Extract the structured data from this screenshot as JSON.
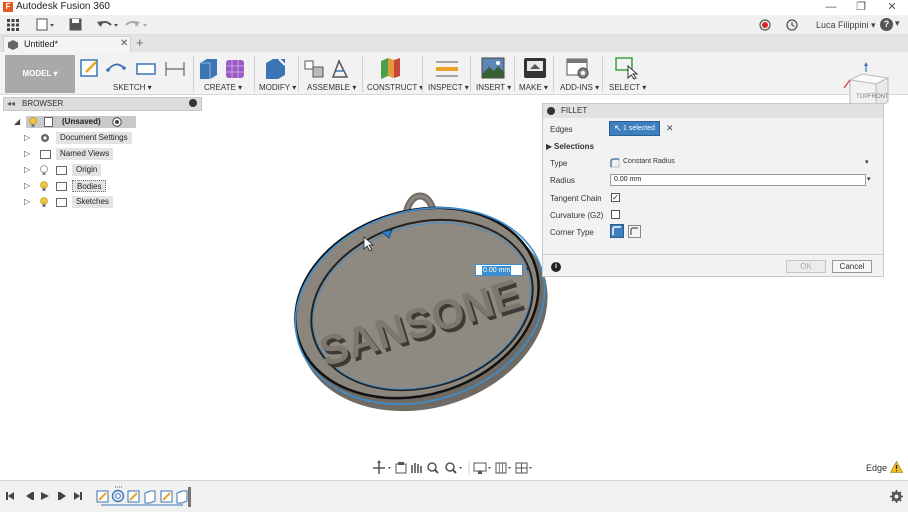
{
  "window": {
    "title": "Autodesk Fusion 360",
    "logo_letter": "F",
    "minimize": "—",
    "restore": "❐",
    "close": "✕"
  },
  "quickbar": {
    "user_name": "Luca Filippini",
    "user_caret": "▾",
    "help_label": "?",
    "help_caret": "▾"
  },
  "tab": {
    "name": "Untitled*",
    "close": "✕",
    "new_tab": "+"
  },
  "ribbon": {
    "workspace": "MODEL",
    "workspace_caret": "▾",
    "groups": [
      "SKETCH",
      "CREATE",
      "MODIFY",
      "ASSEMBLE",
      "CONSTRUCT",
      "INSPECT",
      "INSERT",
      "MAKE",
      "ADD-INS",
      "SELECT"
    ]
  },
  "viewcube": {
    "front_label": "FRONT",
    "top_label": "TOP"
  },
  "browser": {
    "title": "BROWSER",
    "root": "(Unsaved)",
    "items": [
      "Document Settings",
      "Named Views",
      "Origin",
      "Bodies",
      "Sketches"
    ]
  },
  "model": {
    "text": "SANSONE",
    "inline_value": "0.00 mm"
  },
  "fillet": {
    "title": "FILLET",
    "edges_label": "Edges",
    "edges_value": "1 selected",
    "edges_clear": "✕",
    "selections_label": "Selections",
    "type_label": "Type",
    "type_value": "Constant Radius",
    "radius_label": "Radius",
    "radius_value": "0.00 mm",
    "tangent_label": "Tangent Chain",
    "tangent_checked": true,
    "curvature_label": "Curvature (G2)",
    "curvature_checked": false,
    "corner_label": "Corner Type",
    "info_icon": "i",
    "ok_label": "OK",
    "cancel_label": "Cancel"
  },
  "status": {
    "edge_label": "Edge"
  },
  "colors": {
    "accent": "#3b8ed0",
    "selection_badge": "#3d7fbf",
    "model_button": "#a9a9a9",
    "record_red": "#d9272d"
  }
}
